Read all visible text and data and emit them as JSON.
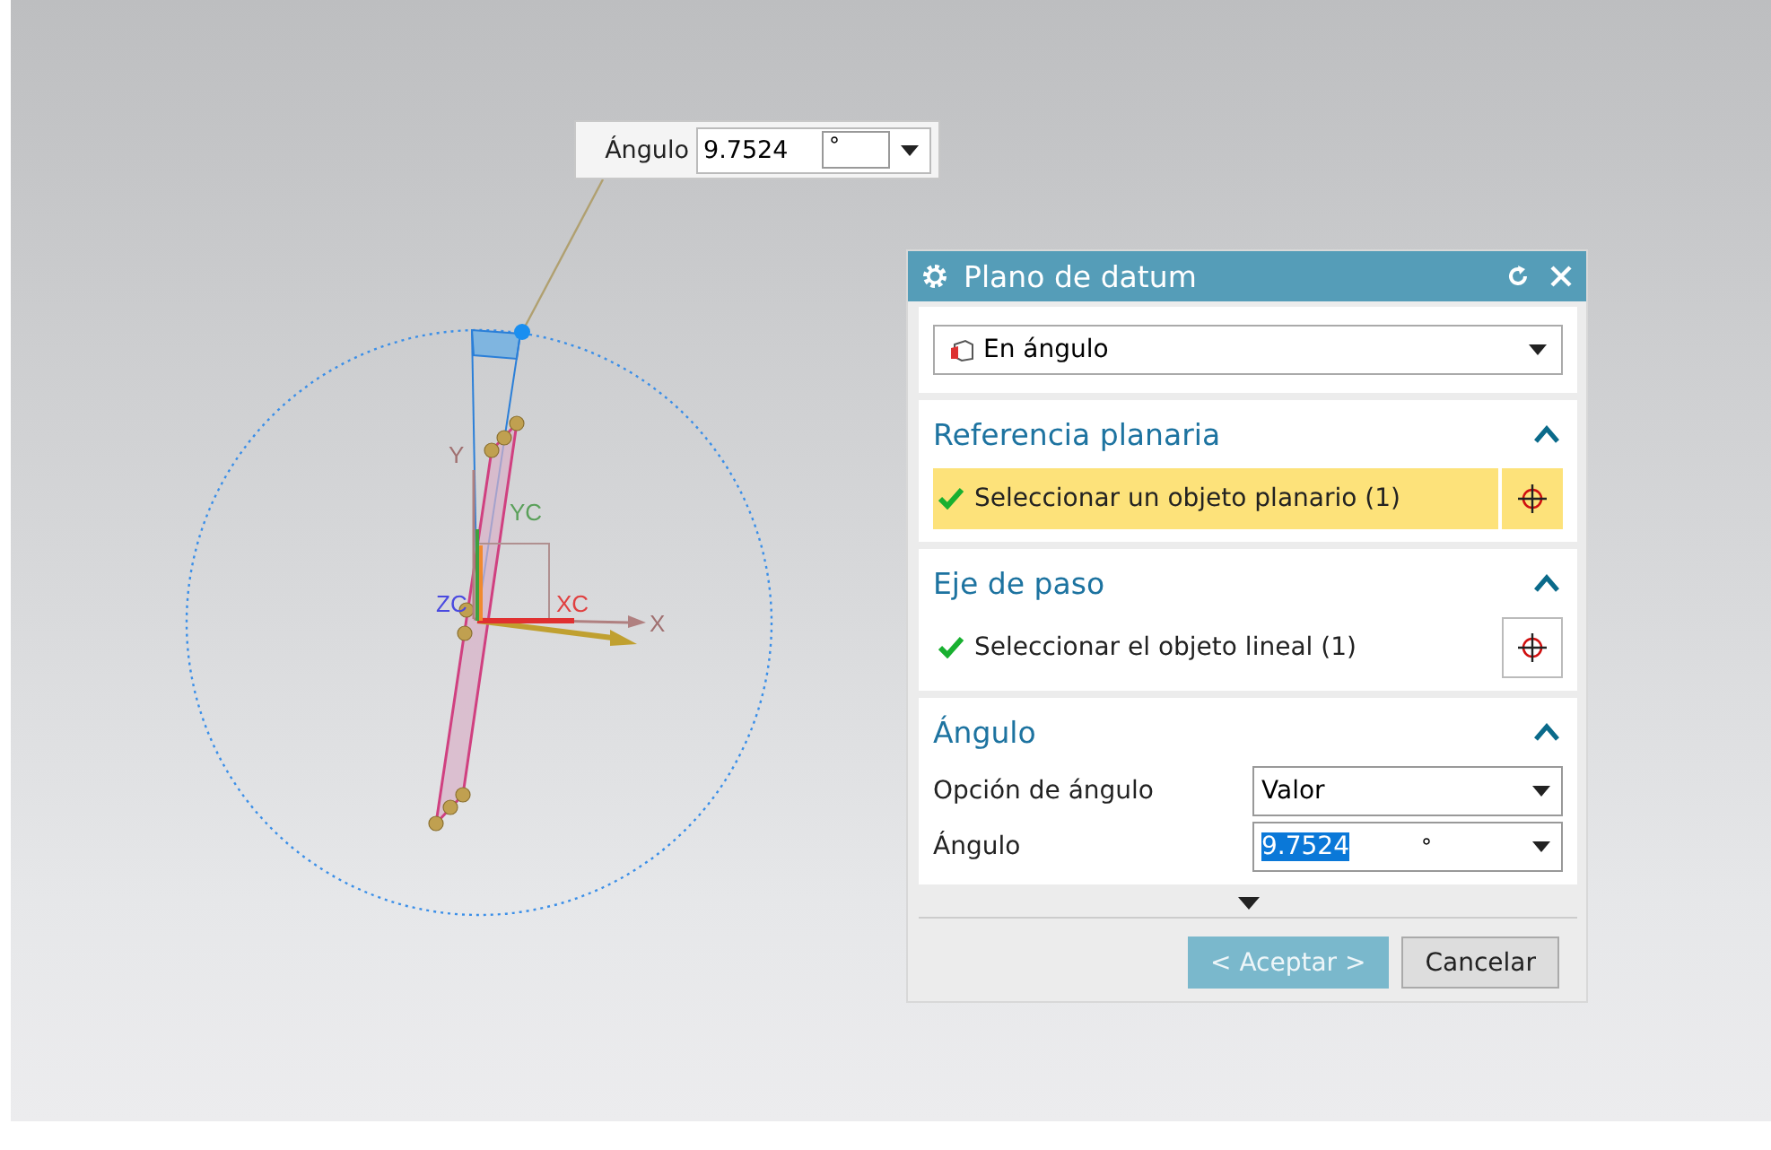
{
  "viewport": {
    "axis_labels": [
      {
        "text": "Y",
        "color": "#a07070"
      },
      {
        "text": "YC",
        "color": "#5aa05a"
      },
      {
        "text": "ZC",
        "color": "#4a4ae0"
      },
      {
        "text": "XC",
        "color": "#e04040"
      },
      {
        "text": "X",
        "color": "#a07070"
      }
    ]
  },
  "angle_popup": {
    "label": "Ángulo",
    "value": "9.7524",
    "unit": "°"
  },
  "dialog": {
    "title": "Plano de datum",
    "type_select": {
      "value": "En ángulo"
    },
    "sections": [
      {
        "kind": "selector",
        "title": "Referencia planaria",
        "expanded": true,
        "selector": {
          "label": "Seleccionar un objeto planario (1)",
          "done": true,
          "selected": true
        }
      },
      {
        "kind": "selector",
        "title": "Eje de paso",
        "expanded": true,
        "selector": {
          "label": "Seleccionar el objeto lineal (1)",
          "done": true,
          "selected": false
        }
      },
      {
        "kind": "fields",
        "title": "Ángulo",
        "expanded": true,
        "fields": [
          {
            "label": "Opción de ángulo",
            "value": "Valor",
            "selected": false
          },
          {
            "label": "Ángulo",
            "value": "9.7524",
            "unit": "°",
            "selected": true
          }
        ]
      }
    ],
    "buttons": [
      {
        "label": "< Aceptar >",
        "kind": "primary"
      },
      {
        "label": "Cancelar",
        "kind": "secondary"
      }
    ]
  }
}
